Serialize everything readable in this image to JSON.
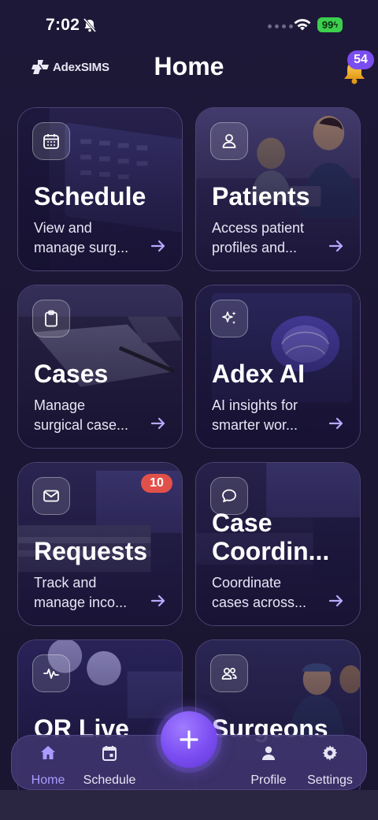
{
  "status_bar": {
    "time": "7:02",
    "battery": "99"
  },
  "header": {
    "logo_text": "AdexSIMS",
    "title": "Home",
    "notification_count": "54"
  },
  "cards": [
    {
      "title": "Schedule",
      "desc_line1": "View and",
      "desc_line2": "manage surg...",
      "icon": "calendar-icon"
    },
    {
      "title": "Patients",
      "desc_line1": "Access patient",
      "desc_line2": "profiles and...",
      "icon": "person-icon"
    },
    {
      "title": "Cases",
      "desc_line1": "Manage",
      "desc_line2": "surgical case...",
      "icon": "clipboard-icon"
    },
    {
      "title": "Adex AI",
      "desc_line1": "AI insights for",
      "desc_line2": "smarter wor...",
      "icon": "sparkles-icon"
    },
    {
      "title": "Requests",
      "desc_line1": "Track and",
      "desc_line2": "manage inco...",
      "icon": "mail-icon",
      "badge": "10"
    },
    {
      "title_line1": "Case",
      "title_line2": "Coordin...",
      "desc_line1": "Coordinate",
      "desc_line2": "cases across...",
      "icon": "chat-icon"
    },
    {
      "title": "OR Live",
      "icon": "pulse-icon"
    },
    {
      "title": "Surgeons",
      "icon": "people-icon"
    }
  ],
  "nav": {
    "home": "Home",
    "schedule": "Schedule",
    "profile": "Profile",
    "settings": "Settings"
  },
  "colors": {
    "accent": "#7b4df2",
    "badge_red": "#e2504a",
    "active_tab": "#a99cff"
  }
}
